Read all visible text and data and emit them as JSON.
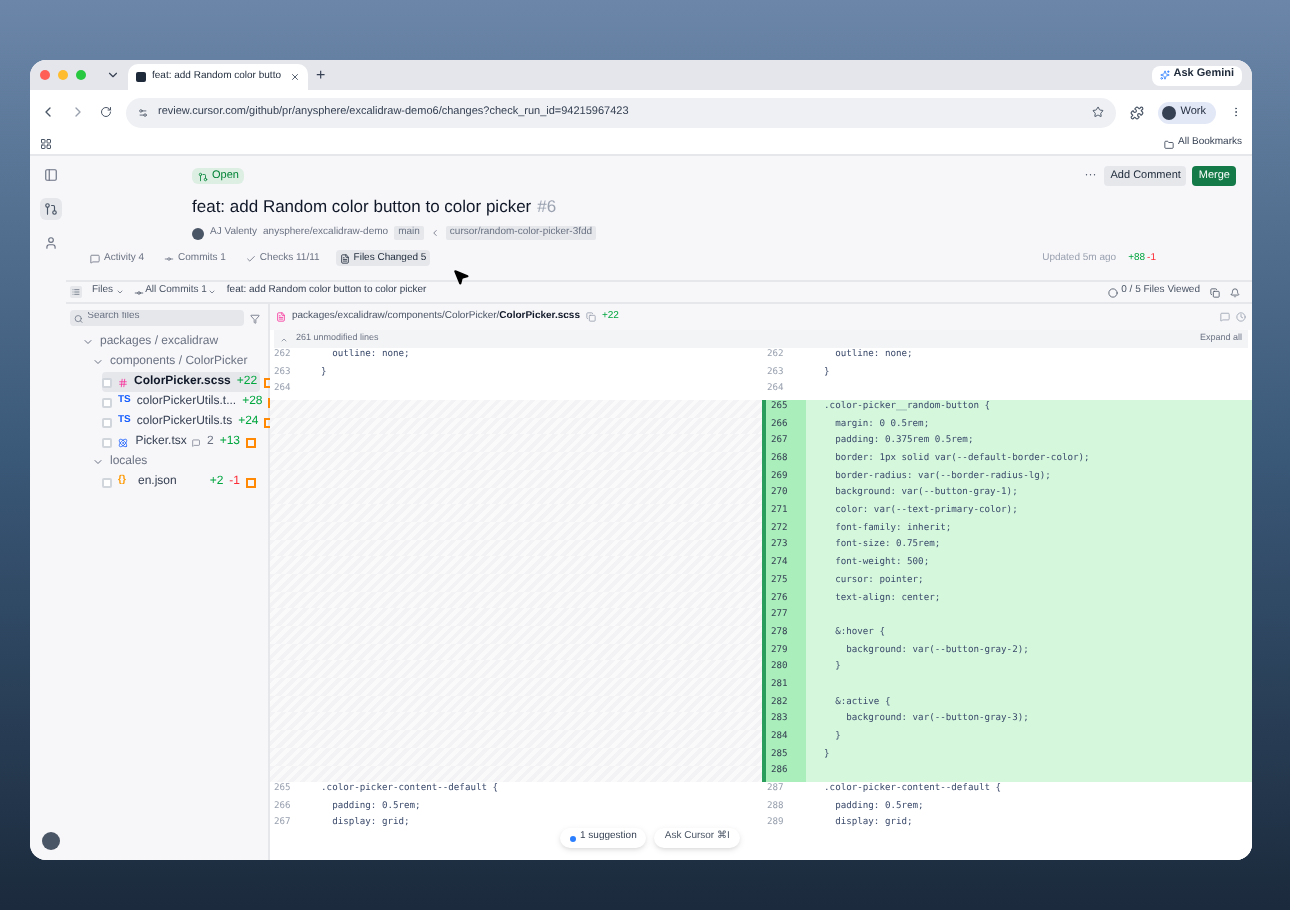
{
  "browser": {
    "tab_title": "feat: add Random color butto",
    "new_tab": "+",
    "ask": "Ask Gemini",
    "url": "review.cursor.com/github/pr/anysphere/excalidraw-demo6/changes?check_run_id=94215967423",
    "profile": "Work",
    "bookmarks": "All Bookmarks"
  },
  "pr": {
    "status": "Open",
    "title": "feat: add Random color button to color picker",
    "number": "#6",
    "author": "AJ Valenty",
    "repo": "anysphere/excalidraw-demo",
    "base": "main",
    "head": "cursor/random-color-picker-3fdd",
    "more": "···",
    "comment": "Add Comment",
    "merge": "Merge",
    "updated": "Updated 5m ago",
    "add": "+88",
    "del": "-1"
  },
  "tabs": [
    {
      "label": "Activity",
      "count": "4",
      "selected": false
    },
    {
      "label": "Commits",
      "count": "1",
      "selected": false
    },
    {
      "label": "Checks",
      "count": "11/11",
      "selected": false
    },
    {
      "label": "Files Changed",
      "count": "5",
      "selected": true
    }
  ],
  "toolbar": {
    "files": "Files",
    "commits": "All Commits",
    "commits_count": "1",
    "title": "feat: add Random color button to color picker",
    "viewed": "0 / 5 Files Viewed"
  },
  "search": {
    "placeholder": "Search files"
  },
  "tree": [
    {
      "kind": "folder",
      "label": "packages / excalidraw",
      "expanded": true,
      "children": [
        {
          "kind": "folder",
          "label": "components / ColorPicker",
          "expanded": true,
          "children": [
            {
              "kind": "scss",
              "label": "ColorPicker.scss",
              "add": "+22",
              "selected": true
            },
            {
              "kind": "ts",
              "badge": "TS",
              "label": "colorPickerUtils.t...",
              "add": "+28",
              "selected": false
            },
            {
              "kind": "ts",
              "badge": "TS",
              "label": "colorPickerUtils.ts",
              "add": "+24",
              "selected": false
            },
            {
              "kind": "tsx",
              "label": "Picker.tsx",
              "comments": "2",
              "add": "+13",
              "selected": false
            }
          ]
        },
        {
          "kind": "folder",
          "label": "locales",
          "expanded": true,
          "children": [
            {
              "kind": "json",
              "badge": "{}",
              "label": "en.json",
              "add": "+2",
              "del": "-1",
              "selected": false
            }
          ]
        }
      ]
    }
  ],
  "diff": {
    "path": "packages/excalidraw/components/ColorPicker/",
    "file": "ColorPicker.scss",
    "add": "+22",
    "collapsed": "261 unmodified lines",
    "expand": "Expand all",
    "rows": [
      {
        "kind": "context",
        "ln": "262",
        "lc": "    outline: none;",
        "rn": "262",
        "rc": "    outline: none;"
      },
      {
        "kind": "context",
        "ln": "263",
        "lc": "  }",
        "rn": "263",
        "rc": "  }"
      },
      {
        "kind": "context",
        "ln": "264",
        "lc": "",
        "rn": "264",
        "rc": ""
      },
      {
        "kind": "added",
        "rn": "265",
        "rc": "  .color-picker__random-button {"
      },
      {
        "kind": "added",
        "rn": "266",
        "rc": "    margin: 0 0.5rem;"
      },
      {
        "kind": "added",
        "rn": "267",
        "rc": "    padding: 0.375rem 0.5rem;"
      },
      {
        "kind": "added",
        "rn": "268",
        "rc": "    border: 1px solid var(--default-border-color);"
      },
      {
        "kind": "added",
        "rn": "269",
        "rc": "    border-radius: var(--border-radius-lg);"
      },
      {
        "kind": "added",
        "rn": "270",
        "rc": "    background: var(--button-gray-1);"
      },
      {
        "kind": "added",
        "rn": "271",
        "rc": "    color: var(--text-primary-color);"
      },
      {
        "kind": "added",
        "rn": "272",
        "rc": "    font-family: inherit;"
      },
      {
        "kind": "added",
        "rn": "273",
        "rc": "    font-size: 0.75rem;"
      },
      {
        "kind": "added",
        "rn": "274",
        "rc": "    font-weight: 500;"
      },
      {
        "kind": "added",
        "rn": "275",
        "rc": "    cursor: pointer;"
      },
      {
        "kind": "added",
        "rn": "276",
        "rc": "    text-align: center;"
      },
      {
        "kind": "added",
        "rn": "277",
        "rc": ""
      },
      {
        "kind": "added",
        "rn": "278",
        "rc": "    &:hover {"
      },
      {
        "kind": "added",
        "rn": "279",
        "rc": "      background: var(--button-gray-2);"
      },
      {
        "kind": "added",
        "rn": "280",
        "rc": "    }"
      },
      {
        "kind": "added",
        "rn": "281",
        "rc": ""
      },
      {
        "kind": "added",
        "rn": "282",
        "rc": "    &:active {"
      },
      {
        "kind": "added",
        "rn": "283",
        "rc": "      background: var(--button-gray-3);"
      },
      {
        "kind": "added",
        "rn": "284",
        "rc": "    }"
      },
      {
        "kind": "added",
        "rn": "285",
        "rc": "  }"
      },
      {
        "kind": "added",
        "rn": "286",
        "rc": ""
      },
      {
        "kind": "context",
        "ln": "265",
        "lc": "  .color-picker-content--default {",
        "rn": "287",
        "rc": "  .color-picker-content--default {"
      },
      {
        "kind": "context",
        "ln": "266",
        "lc": "    padding: 0.5rem;",
        "rn": "288",
        "rc": "    padding: 0.5rem;"
      },
      {
        "kind": "context",
        "ln": "267",
        "lc": "    display: grid;",
        "rn": "289",
        "rc": "    display: grid;"
      }
    ]
  },
  "floating": {
    "suggestion": "1 suggestion",
    "ask": "Ask Cursor ⌘I"
  }
}
